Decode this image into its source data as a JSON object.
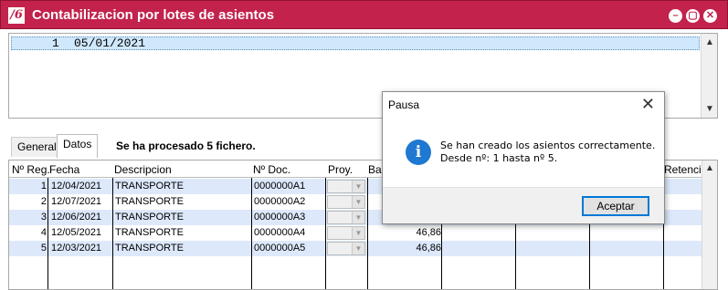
{
  "window": {
    "title": "Contabilizacion por lotes de asientos",
    "logo": "/6",
    "buttons": {
      "minimize": "–",
      "maximize": "▢",
      "close": "✕"
    }
  },
  "top_list": {
    "rows": [
      {
        "num": "1",
        "date": "05/01/2021"
      }
    ]
  },
  "tabs": [
    {
      "label": "General",
      "selected": false
    },
    {
      "label": "Datos",
      "selected": true
    }
  ],
  "status_message": "Se ha procesado 5 fichero.",
  "grid": {
    "columns": [
      "Nº Reg.",
      "Fecha",
      "Descripcion",
      "Nº Doc.",
      "Proy.",
      "Bas",
      "Retenció"
    ],
    "rows": [
      {
        "reg": "1",
        "fecha": "12/04/2021",
        "desc": "TRANSPORTE",
        "doc": "0000000A1",
        "base": ""
      },
      {
        "reg": "2",
        "fecha": "12/07/2021",
        "desc": "TRANSPORTE",
        "doc": "0000000A2",
        "base": ""
      },
      {
        "reg": "3",
        "fecha": "12/06/2021",
        "desc": "TRANSPORTE",
        "doc": "0000000A3",
        "base": ""
      },
      {
        "reg": "4",
        "fecha": "12/05/2021",
        "desc": "TRANSPORTE",
        "doc": "0000000A4",
        "base": "46,86"
      },
      {
        "reg": "5",
        "fecha": "12/03/2021",
        "desc": "TRANSPORTE",
        "doc": "0000000A5",
        "base": "46,86"
      }
    ]
  },
  "dialog": {
    "title": "Pausa",
    "close": "✕",
    "line1": "Se han creado los asientos correctamente.",
    "line2": "Desde nº: 1 hasta nº 5.",
    "ok_label": "Aceptar",
    "icon": "info-icon"
  },
  "colors": {
    "titlebar": "#c3224c",
    "selection": "#cfe8fb",
    "alt_row": "#dde8fb",
    "info_icon": "#1f78d1",
    "dialog_button_border": "#0078d7"
  }
}
